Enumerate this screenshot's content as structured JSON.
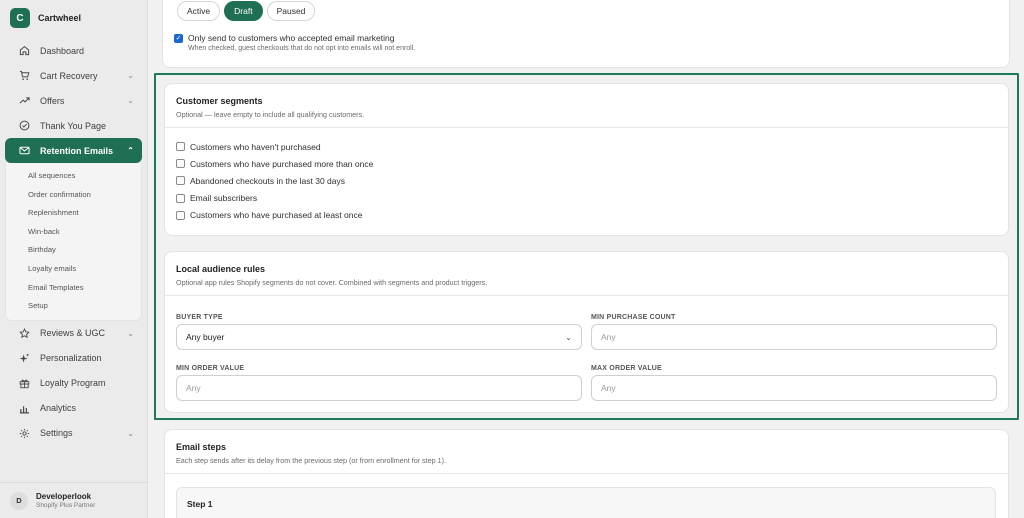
{
  "app": {
    "logo_letter": "C",
    "name": "Cartwheel"
  },
  "sidebar": {
    "items": [
      {
        "label": "Dashboard",
        "icon": "home-icon",
        "chevron": false
      },
      {
        "label": "Cart Recovery",
        "icon": "cart-icon",
        "chevron": true
      },
      {
        "label": "Offers",
        "icon": "trend-icon",
        "chevron": true
      },
      {
        "label": "Thank You Page",
        "icon": "check-circle-icon",
        "chevron": false
      },
      {
        "label": "Retention Emails",
        "icon": "mail-icon",
        "chevron": true,
        "active": true
      },
      {
        "label": "Reviews & UGC",
        "icon": "star-icon",
        "chevron": true
      },
      {
        "label": "Personalization",
        "icon": "sparkle-icon",
        "chevron": false
      },
      {
        "label": "Loyalty Program",
        "icon": "gift-icon",
        "chevron": false
      },
      {
        "label": "Analytics",
        "icon": "bar-chart-icon",
        "chevron": false
      },
      {
        "label": "Settings",
        "icon": "gear-icon",
        "chevron": true
      }
    ],
    "subitems": [
      "All sequences",
      "Order confirmation",
      "Replenishment",
      "Win-back",
      "Birthday",
      "Loyalty emails",
      "Email Templates",
      "Setup"
    ]
  },
  "user": {
    "initial": "D",
    "name": "Developerlook",
    "role": "Shopify Plus Partner"
  },
  "status": {
    "tabs": [
      "Active",
      "Draft",
      "Paused"
    ],
    "selected": "Draft",
    "marketing_label": "Only send to customers who accepted email marketing",
    "marketing_checked": true,
    "marketing_help": "When checked, guest checkouts that do not opt into emails will not enroll."
  },
  "segments": {
    "title": "Customer segments",
    "subtitle": "Optional — leave empty to include all qualifying customers.",
    "options": [
      "Customers who haven't purchased",
      "Customers who have purchased more than once",
      "Abandoned checkouts in the last 30 days",
      "Email subscribers",
      "Customers who have purchased at least once"
    ]
  },
  "rules": {
    "title": "Local audience rules",
    "subtitle": "Optional app rules Shopify segments do not cover. Combined with segments and product triggers.",
    "buyer_type_label": "BUYER TYPE",
    "buyer_type_value": "Any buyer",
    "min_purchase_label": "MIN PURCHASE COUNT",
    "min_purchase_placeholder": "Any",
    "min_order_label": "MIN ORDER VALUE",
    "min_order_placeholder": "Any",
    "max_order_label": "MAX ORDER VALUE",
    "max_order_placeholder": "Any"
  },
  "steps": {
    "title": "Email steps",
    "subtitle": "Each step sends after its delay from the previous step (or from enrollment for step 1).",
    "first_step": "Step 1"
  },
  "colors": {
    "brand": "#1f6f54",
    "highlight": "#1f7a5a",
    "checkbox": "#1a67d2"
  }
}
